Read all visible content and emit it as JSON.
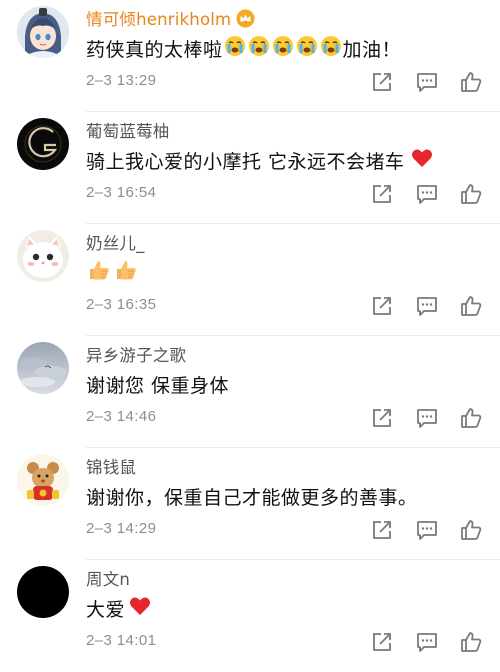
{
  "comments": [
    {
      "name": "情可倾henrikholm",
      "vip": true,
      "badge_icon": "crown-badge-icon",
      "text": "药侠真的太棒啦",
      "emojis": [
        "crying-face-emoji",
        "crying-face-emoji",
        "crying-face-emoji",
        "crying-face-emoji",
        "crying-face-emoji"
      ],
      "text_after": "加油！",
      "time": "2–3 13:29",
      "avatar_icon": "anime-character-avatar"
    },
    {
      "name": "葡萄蓝莓柚",
      "vip": false,
      "text": "骑上我心爱的小摩托 它永远不会堵车",
      "emojis": [
        "red-heart-emoji"
      ],
      "text_after": "",
      "time": "2–3 16:54",
      "avatar_icon": "dark-circle-logo-avatar"
    },
    {
      "name": "奶丝儿_",
      "vip": false,
      "text": "",
      "emojis": [
        "thumbs-up-emoji",
        "thumbs-up-emoji"
      ],
      "text_after": "",
      "time": "2–3 16:35",
      "avatar_icon": "white-cat-avatar"
    },
    {
      "name": "异乡游子之歌",
      "vip": false,
      "text": "谢谢您 保重身体",
      "emojis": [],
      "text_after": "",
      "time": "2–3 14:46",
      "avatar_icon": "cloudy-sky-avatar"
    },
    {
      "name": "锦钱鼠",
      "vip": false,
      "text": "谢谢你，保重自己才能做更多的善事。",
      "emojis": [],
      "text_after": "",
      "time": "2–3 14:29",
      "avatar_icon": "lucky-mouse-avatar"
    },
    {
      "name": "周文n",
      "vip": false,
      "text": "大爱",
      "emojis": [
        "red-heart-emoji"
      ],
      "text_after": "",
      "time": "2–3 14:01",
      "avatar_icon": "black-circle-avatar"
    }
  ],
  "actions": {
    "share_icon": "share-icon",
    "reply_icon": "comment-icon",
    "like_icon": "thumbs-up-like-icon"
  },
  "colors": {
    "vip_name": "#e8851a",
    "name": "#555555",
    "time": "#8e8e8e",
    "icon": "#7a7a7a",
    "heart": "#e5262d"
  }
}
